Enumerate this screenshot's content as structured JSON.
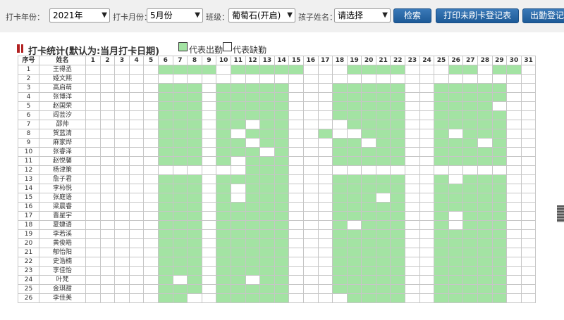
{
  "filters": {
    "year_label": "打卡年份：",
    "year_value": "2021年",
    "month_label": "打卡月份：",
    "month_value": "5月份",
    "class_label": "班级：",
    "class_value": "葡萄石(开启)",
    "child_label": "孩子姓名：",
    "child_value": "请选择",
    "search_button": "检索",
    "print_button": "打印未刷卡登记表",
    "stats_button": "出勤登记"
  },
  "section": {
    "title": "打卡统计(默认为:当月打卡日期)",
    "legend_present": "代表出勤",
    "legend_absent": "代表缺勤",
    "present_color": "#a3e3a3",
    "absent_color": "#ffffff"
  },
  "table": {
    "col_index": "序号",
    "col_name": "姓名",
    "days": [
      "1",
      "2",
      "3",
      "4",
      "5",
      "6",
      "7",
      "8",
      "9",
      "10",
      "11",
      "12",
      "13",
      "14",
      "15",
      "16",
      "17",
      "18",
      "19",
      "20",
      "21",
      "22",
      "23",
      "24",
      "25",
      "26",
      "27",
      "28",
      "29",
      "30",
      "31"
    ],
    "rows": [
      {
        "index": "1",
        "name": "王得丞",
        "att": "0000011110111110001111000110110000"
      },
      {
        "index": "2",
        "name": "姫文熙",
        "att": "0000000000000000000000000000000"
      },
      {
        "index": "3",
        "name": "高启萌",
        "att": "0000011101111100011111001111100"
      },
      {
        "index": "4",
        "name": "张博洋",
        "att": "0000011101111100011111001111100"
      },
      {
        "index": "5",
        "name": "赵国荣",
        "att": "0000011101111100011111001111000"
      },
      {
        "index": "6",
        "name": "阎芸汐",
        "att": "0000011101111100011111001111100"
      },
      {
        "index": "7",
        "name": "邵帅",
        "att": "0000011101101100001111001111100"
      },
      {
        "index": "8",
        "name": "贺蓝清",
        "att": "0000011101011100100111001011100"
      },
      {
        "index": "9",
        "name": "麻家烨",
        "att": "0000011101101100011011001110100"
      },
      {
        "index": "10",
        "name": "张睿泽",
        "att": "0000011101110100011111001111100"
      },
      {
        "index": "11",
        "name": "赵悦馨",
        "att": "0000011101011100011111001111100"
      },
      {
        "index": "12",
        "name": "杨津策",
        "att": "0000000000011100000000000000000"
      },
      {
        "index": "13",
        "name": "詹子君",
        "att": "0000011101111100011111001011100"
      },
      {
        "index": "14",
        "name": "李杺悦",
        "att": "0000011101011100011111001111100"
      },
      {
        "index": "15",
        "name": "张庭语",
        "att": "0000011101011100011101001111100"
      },
      {
        "index": "16",
        "name": "梁晨睿",
        "att": "0000011101111100011111001111100"
      },
      {
        "index": "17",
        "name": "晋星宇",
        "att": "0000011101111100011111001011100"
      },
      {
        "index": "18",
        "name": "夏婕语",
        "att": "0000011101111100010111001011100"
      },
      {
        "index": "19",
        "name": "李若溪",
        "att": "0000011101111100011111001111100"
      },
      {
        "index": "20",
        "name": "黄俊皓",
        "att": "0000011101111100011111001111100"
      },
      {
        "index": "21",
        "name": "郁怡阳",
        "att": "0000011101111100011111001111100"
      },
      {
        "index": "22",
        "name": "史浩楠",
        "att": "0000011101111100011111001111100"
      },
      {
        "index": "23",
        "name": "李佳怡",
        "att": "0000011101111100011111001111100"
      },
      {
        "index": "24",
        "name": "叶梵",
        "att": "0000010101101100011111001111100"
      },
      {
        "index": "25",
        "name": "金琪甜",
        "att": "0000011101111100011111001111100"
      },
      {
        "index": "26",
        "name": "李佳美",
        "att": "0000011001111100001111001111100"
      }
    ]
  }
}
